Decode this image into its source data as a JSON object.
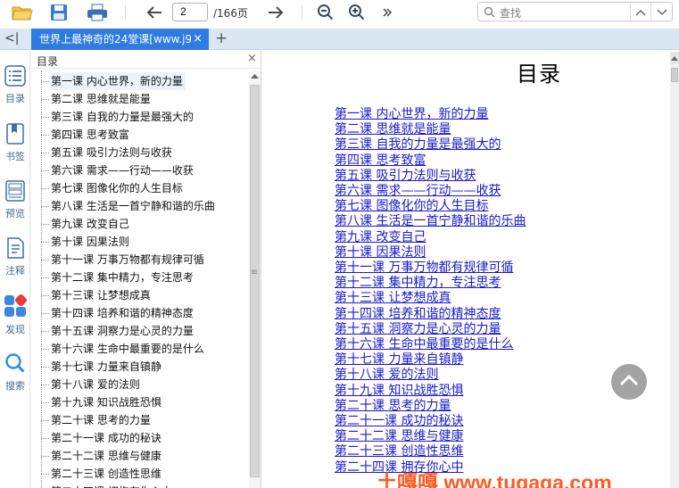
{
  "toolbar": {
    "page_current": "2",
    "page_total": "/166页",
    "search_placeholder": "查找"
  },
  "tabs": [
    {
      "title": "世界上最神奇的24堂课[www.j9",
      "close": "×"
    }
  ],
  "tabbar": {
    "collapse": "<|",
    "new_tab": "+"
  },
  "rail": [
    {
      "label": "目录",
      "icon": "toc-icon"
    },
    {
      "label": "书签",
      "icon": "bookmark-icon"
    },
    {
      "label": "预览",
      "icon": "preview-icon"
    },
    {
      "label": "注释",
      "icon": "annotation-icon"
    },
    {
      "label": "发现",
      "icon": "discover-icon"
    },
    {
      "label": "搜索",
      "icon": "search-icon"
    }
  ],
  "toc": {
    "title": "目录",
    "close": "×",
    "items": [
      "第一课 内心世界，新的力量",
      "第二课 思维就是能量",
      "第三课 自我的力量是最强大的",
      "第四课 思考致富",
      "第五课 吸引力法则与收获",
      "第六课 需求——行动——收获",
      "第七课 图像化你的人生目标",
      "第八课 生活是一首宁静和谐的乐曲",
      "第九课 改变自己",
      "第十课 因果法则",
      "第十一课 万事万物都有规律可循",
      "第十二课 集中精力，专注思考",
      "第十三课 让梦想成真",
      "第十四课 培养和谐的精神态度",
      "第十五课 洞察力是心灵的力量",
      "第十六课 生命中最重要的是什么",
      "第十七课 力量来自镇静",
      "第十八课 爱的法则",
      "第十九课 知识战胜恐惧",
      "第二十课 思考的力量",
      "第二十一课 成功的秘诀",
      "第二十二课 思维与健康",
      "第二十三课 创造性思维",
      "第二十四课 拥抱存你心中"
    ]
  },
  "document": {
    "title": "目录",
    "links": [
      "第一课 内心世界，新的力量",
      "第二课 思维就是能量",
      "第三课 自我的力量是最强大的",
      "第四课 思考致富",
      "第五课 吸引力法则与收获",
      "第六课 需求——行动——收获",
      "第七课 图像化你的人生目标",
      "第八课 生活是一首宁静和谐的乐曲",
      "第九课 改变自己",
      "第十课 因果法则",
      "第十一课 万事万物都有规律可循",
      "第十二课 集中精力，专注思考",
      "第十三课 让梦想成真",
      "第十四课 培养和谐的精神态度",
      "第十五课 洞察力是心灵的力量",
      "第十六课 生命中最重要的是什么",
      "第十七课 力量来自镇静",
      "第十八课 爱的法则",
      "第十九课 知识战胜恐惧",
      "第二十课 思考的力量",
      "第二十一课 成功的秘诀",
      "第二十二课 思维与健康",
      "第二十三课 创造性思维",
      "第二十四课 拥存你心中"
    ]
  },
  "watermark": "土嘎嘎 www.tugaga.com",
  "colors": {
    "accent": "#2f7be0",
    "link": "#1a1acb",
    "watermark": "#ff5a1f"
  }
}
